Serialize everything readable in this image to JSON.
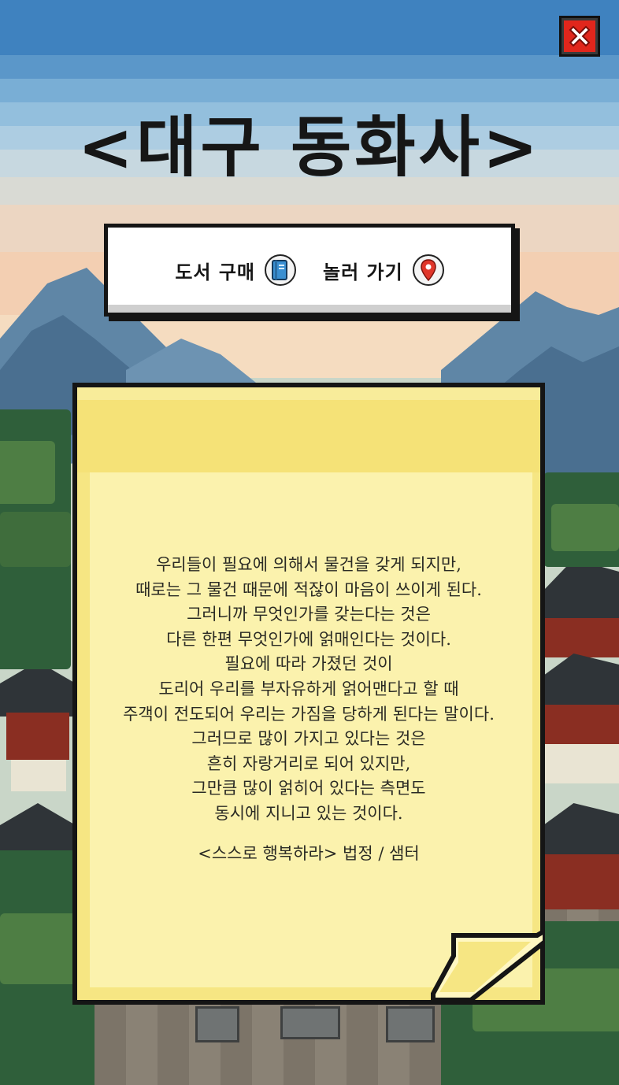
{
  "title": "<대구 동화사>",
  "close_button": {
    "icon": "close-x-icon",
    "color": "#e1261c"
  },
  "menu": {
    "items": [
      {
        "label": "도서 구매",
        "icon": "book-icon"
      },
      {
        "label": "놀러 가기",
        "icon": "map-pin-icon"
      }
    ]
  },
  "note": {
    "lines": [
      "우리들이 필요에 의해서 물건을 갖게 되지만,",
      "때로는 그 물건 때문에 적잖이 마음이 쓰이게 된다.",
      "그러니까 무엇인가를 갖는다는 것은",
      "다른 한편 무엇인가에 얽매인다는 것이다.",
      "필요에 따라 가졌던 것이",
      "도리어 우리를 부자유하게 얽어맨다고 할 때",
      "주객이 전도되어 우리는 가짐을 당하게 된다는 말이다.",
      "그러므로 많이 가지고 있다는 것은",
      "흔히 자랑거리로 되어 있지만,",
      "그만큼 많이 얽히어 있다는 측면도",
      "동시에 지니고 있는 것이다."
    ],
    "source": "<스스로 행복하라> 법정 / 샘터",
    "paper_color": "#f6e683"
  }
}
